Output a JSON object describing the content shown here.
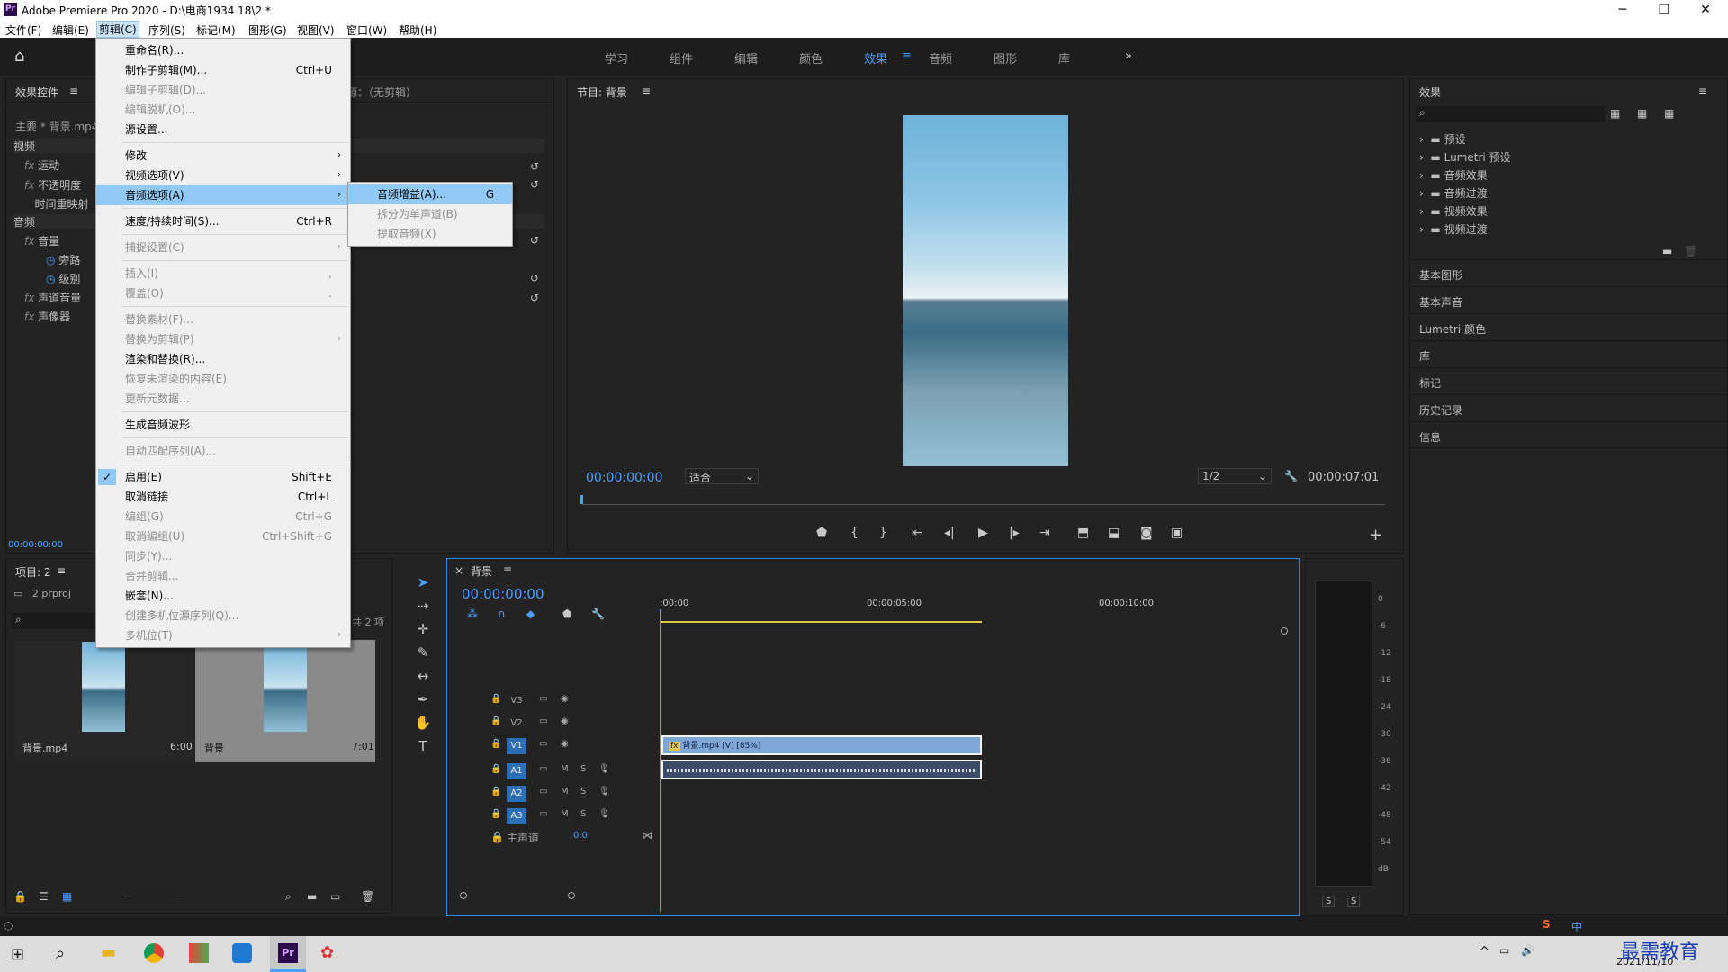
{
  "window": {
    "title": "Adobe Premiere Pro 2020 - D:\\电商1934 18\\2 *",
    "logo": "Pr"
  },
  "menubar": [
    "文件(F)",
    "编辑(E)",
    "剪辑(C)",
    "序列(S)",
    "标记(M)",
    "图形(G)",
    "视图(V)",
    "窗口(W)",
    "帮助(H)"
  ],
  "workspaces": [
    "学习",
    "组件",
    "编辑",
    "颜色",
    "效果",
    "音频",
    "图形",
    "库"
  ],
  "fx_panel": {
    "tab": "效果控件",
    "src_tab": "源：（无剪辑）",
    "clip": "主要 * 背景.mp4",
    "video": "视频",
    "audio": "音频",
    "motion": "运动",
    "opacity": "不透明度",
    "timeremap": "时间重映射",
    "volume": "音量",
    "bypass": "旁路",
    "level": "级别",
    "channelvol": "声道音量",
    "panner": "声像器",
    "time": "00:00:00:00"
  },
  "program": {
    "title": "节目: 背景",
    "timecode": "00:00:00:00",
    "fit": "适合",
    "res": "1/2",
    "duration": "00:00:07:01"
  },
  "effects": {
    "title": "效果",
    "items": [
      "预设",
      "Lumetri 预设",
      "音频效果",
      "音频过渡",
      "视频效果",
      "视频过渡"
    ],
    "side": [
      "基本图形",
      "基本声音",
      "Lumetri 颜色",
      "库",
      "标记",
      "历史记录",
      "信息"
    ]
  },
  "project": {
    "title": "项目: 2",
    "file": "2.prproj",
    "count": "共 2 项",
    "items": [
      {
        "name": "背景.mp4",
        "dur": "6:00"
      },
      {
        "name": "背景",
        "dur": "7:01"
      }
    ]
  },
  "timeline": {
    "title": "背景",
    "timecode": "00:00:00:00",
    "ruler": [
      ":00:00",
      "00:00:05:00",
      "00:00:10:00"
    ],
    "tracks": [
      "V3",
      "V2",
      "V1",
      "A1",
      "A2",
      "A3"
    ],
    "master": "主声道",
    "master_val": "0.0",
    "clip_v": "背景.mp4 [V] [85%]",
    "m": "M",
    "s": "S"
  },
  "meters": {
    "labels": [
      "0",
      "-6",
      "-12",
      "-18",
      "-24",
      "-30",
      "-36",
      "-42",
      "-48",
      "-54",
      "dB"
    ],
    "s": "S"
  },
  "clip_menu": [
    {
      "label": "重命名(R)...",
      "key": "",
      "dis": false
    },
    {
      "label": "制作子剪辑(M)...",
      "key": "Ctrl+U",
      "dis": false
    },
    {
      "label": "编辑子剪辑(D)...",
      "key": "",
      "dis": true
    },
    {
      "label": "编辑脱机(O)...",
      "key": "",
      "dis": true
    },
    {
      "label": "源设置...",
      "key": "",
      "dis": false
    },
    {
      "label": "修改",
      "key": "",
      "dis": false
    },
    {
      "label": "视频选项(V)",
      "key": "",
      "dis": false
    },
    {
      "label": "音频选项(A)",
      "key": "",
      "dis": false
    },
    {
      "label": "速度/持续时间(S)...",
      "key": "Ctrl+R",
      "dis": false
    },
    {
      "label": "捕捉设置(C)",
      "key": "",
      "dis": true
    },
    {
      "label": "插入(I)",
      "key": ",",
      "dis": true
    },
    {
      "label": "覆盖(O)",
      "key": ".",
      "dis": true
    },
    {
      "label": "替换素材(F)...",
      "key": "",
      "dis": true
    },
    {
      "label": "替换为剪辑(P)",
      "key": "",
      "dis": true
    },
    {
      "label": "渲染和替换(R)...",
      "key": "",
      "dis": false
    },
    {
      "label": "恢复未渲染的内容(E)",
      "key": "",
      "dis": true
    },
    {
      "label": "更新元数据...",
      "key": "",
      "dis": true
    },
    {
      "label": "生成音频波形",
      "key": "",
      "dis": false
    },
    {
      "label": "自动匹配序列(A)...",
      "key": "",
      "dis": true
    },
    {
      "label": "启用(E)",
      "key": "Shift+E",
      "dis": false
    },
    {
      "label": "取消链接",
      "key": "Ctrl+L",
      "dis": false
    },
    {
      "label": "编组(G)",
      "key": "Ctrl+G",
      "dis": true
    },
    {
      "label": "取消编组(U)",
      "key": "Ctrl+Shift+G",
      "dis": true
    },
    {
      "label": "同步(Y)...",
      "key": "",
      "dis": true
    },
    {
      "label": "合并剪辑...",
      "key": "",
      "dis": true
    },
    {
      "label": "嵌套(N)...",
      "key": "",
      "dis": false
    },
    {
      "label": "创建多机位源序列(Q)...",
      "key": "",
      "dis": true
    },
    {
      "label": "多机位(T)",
      "key": "",
      "dis": true
    }
  ],
  "sub_menu": [
    {
      "label": "音频增益(A)...",
      "key": "G"
    },
    {
      "label": "拆分为单声道(B)",
      "key": ""
    },
    {
      "label": "提取音频(X)",
      "key": ""
    }
  ],
  "taskbar": {
    "date": "2021/11/10",
    "ime": "中",
    "brand": "最需教育"
  },
  "colors": {
    "accent": "#2d8ceb",
    "blue_text": "#4b9fff",
    "menu_hl": "#91c9f7"
  }
}
